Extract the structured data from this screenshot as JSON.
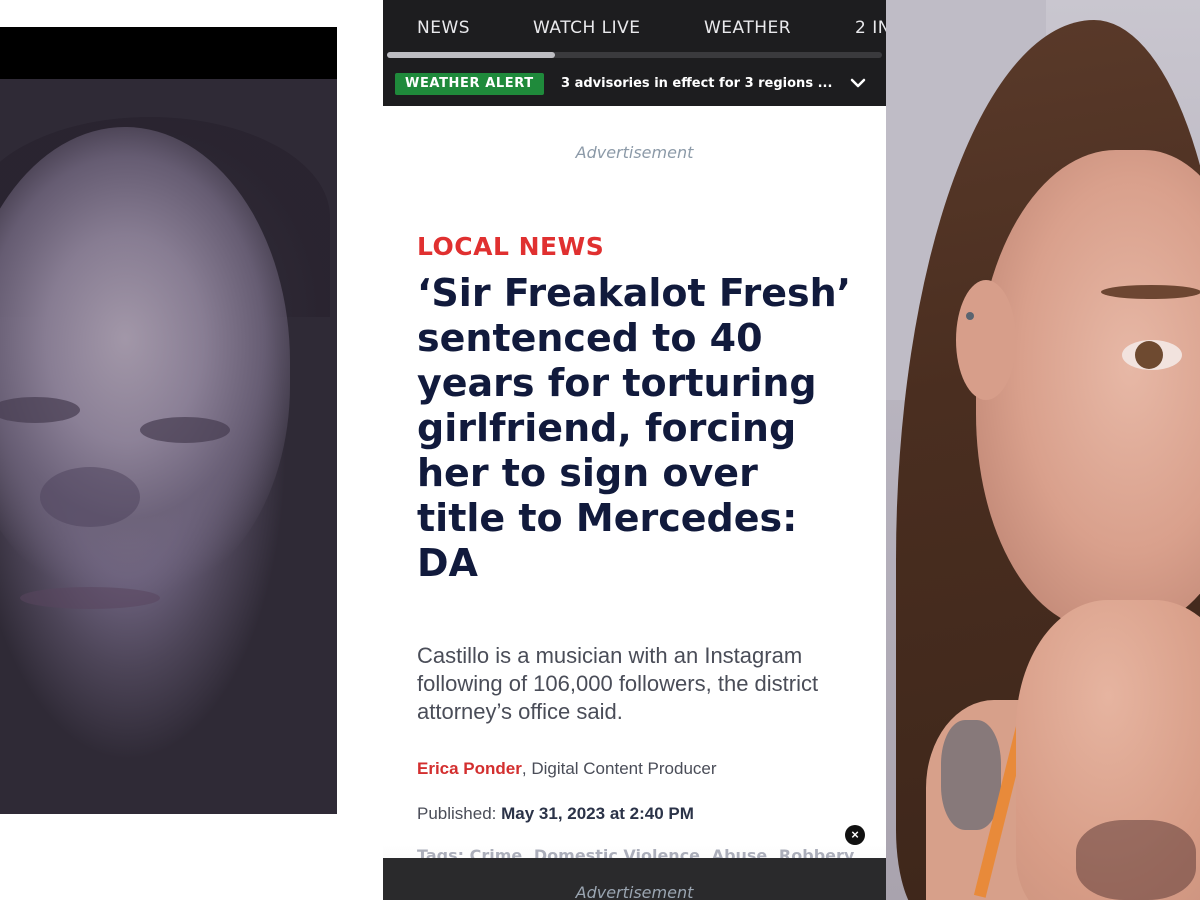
{
  "nav": {
    "items": [
      "NEWS",
      "WATCH LIVE",
      "WEATHER",
      "2 IN"
    ]
  },
  "alert": {
    "badge": "WEATHER ALERT",
    "text": "3 advisories in effect for 3 regions ...",
    "color": "#1f8a3b"
  },
  "ads": {
    "top_label": "Advertisement",
    "bottom_label": "Advertisement"
  },
  "article": {
    "section": "LOCAL NEWS",
    "headline": "‘Sir Freakalot Fresh’ sentenced to 40 years for torturing girlfriend, forcing her to sign over title to Mercedes: DA",
    "subhead": "Castillo is a musician with an Instagram following of 106,000 followers, the district attorney’s office said.",
    "author": "Erica Ponder",
    "author_role": ", Digital Content Producer",
    "published_label": "Published: ",
    "published_date": "May 31, 2023 at 2:40 PM",
    "tags_partial": "Tags: Crime, Domestic Violence, Abuse, Robbery"
  },
  "colors": {
    "section_red": "#e03030",
    "headline_navy": "#111a3c",
    "nav_bg": "#1d1d1f"
  },
  "icons": {
    "alert_chevron": "chevron-down-icon",
    "close_ad": "close-icon"
  }
}
